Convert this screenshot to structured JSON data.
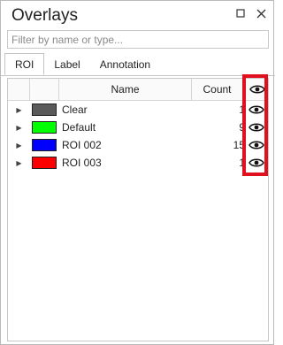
{
  "panel": {
    "title": "Overlays",
    "restore_icon": "maximize-icon",
    "close_icon": "close-icon"
  },
  "filter": {
    "placeholder": "Filter by name or type...",
    "value": ""
  },
  "tabs": [
    {
      "label": "ROI",
      "active": true
    },
    {
      "label": "Label",
      "active": false
    },
    {
      "label": "Annotation",
      "active": false
    }
  ],
  "grid": {
    "columns": {
      "name": "Name",
      "count": "Count",
      "visibility_icon": "eye-icon"
    },
    "rows": [
      {
        "name": "Clear",
        "count": "1",
        "color": "#5a5a5a"
      },
      {
        "name": "Default",
        "count": "9",
        "color": "#00ff00"
      },
      {
        "name": "ROI 002",
        "count": "15",
        "color": "#0000ff"
      },
      {
        "name": "ROI 003",
        "count": "1",
        "color": "#ff0000"
      }
    ]
  },
  "colors": {
    "highlight": "#e0101e"
  }
}
